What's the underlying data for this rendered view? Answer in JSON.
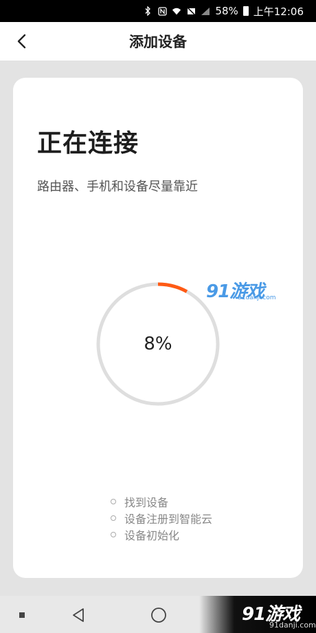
{
  "status_bar": {
    "battery": "58%",
    "time": "上午12:06"
  },
  "header": {
    "title": "添加设备"
  },
  "card": {
    "heading": "正在连接",
    "subtitle": "路由器、手机和设备尽量靠近"
  },
  "progress": {
    "label": "8%",
    "value": 0.08,
    "track_color": "#dedede",
    "fill_color": "#ff5a14"
  },
  "steps": [
    {
      "label": "找到设备"
    },
    {
      "label": "设备注册到智能云"
    },
    {
      "label": "设备初始化"
    }
  ],
  "watermarks": {
    "center": {
      "logo": "91游戏",
      "url": "91danji.com"
    },
    "corner": {
      "logo": "91游戏",
      "url": "91danji.com"
    }
  },
  "icons": {
    "back": "chevron-left-icon",
    "nav_recent": "square-icon",
    "nav_back": "triangle-back-icon",
    "nav_home": "circle-home-icon"
  }
}
